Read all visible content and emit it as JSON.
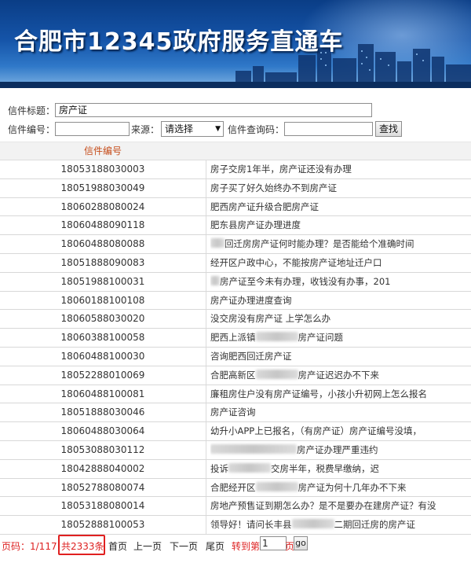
{
  "header": {
    "title": "合肥市12345政府服务直通车"
  },
  "form": {
    "subject_label": "信件标题：",
    "subject_value": "房产证",
    "number_label": "信件编号：",
    "number_value": "",
    "source_label": "来源：",
    "source_selected": "请选择",
    "query_code_label": "信件查询码：",
    "query_code_value": "",
    "search_button": "查找"
  },
  "table": {
    "header_number": "信件编号",
    "rows": [
      {
        "id": "18053188030003",
        "subject": "房子交房1年半，房产证还没有办理"
      },
      {
        "id": "18051988030049",
        "subject": "房子买了好久始终办不到房产证"
      },
      {
        "id": "18060288080024",
        "subject": "肥西房产证升级合肥房产证"
      },
      {
        "id": "18060488090118",
        "subject": "肥东县房产证办理进度"
      },
      {
        "id": "18060488080088",
        "subject": "回迁房房产证何时能办理？是否能给个准确时间"
      },
      {
        "id": "18051888090083",
        "subject": "经开区户政中心，不能按房产证地址迁户口"
      },
      {
        "id": "18051988100031",
        "subject": "房产证至今未有办理，收钱没有办事，201"
      },
      {
        "id": "18060188100108",
        "subject": "房产证办理进度查询"
      },
      {
        "id": "18060588030020",
        "subject": "没交房没有房产证 上学怎么办"
      },
      {
        "id": "18060388100058",
        "subject": "肥西上派镇",
        "subject_after": "房产证问题"
      },
      {
        "id": "18060488100030",
        "subject": "咨询肥西回迁房产证"
      },
      {
        "id": "18052288010069",
        "subject": "合肥高新区",
        "subject_after": "房产证迟迟办不下来"
      },
      {
        "id": "18060488100081",
        "subject": "廉租房住户没有房产证编号，小孩小升初网上怎么报名"
      },
      {
        "id": "18051888030046",
        "subject": "房产证咨询"
      },
      {
        "id": "18060488030064",
        "subject": "幼升小APP上已报名，（有房产证）房产证编号没填，"
      },
      {
        "id": "18053088030112",
        "subject": "",
        "subject_after": "房产证办理严重违约"
      },
      {
        "id": "18042888040002",
        "subject": "投诉",
        "subject_after": "交房半年，税费早缴纳，迟"
      },
      {
        "id": "18052788080074",
        "subject": "合肥经开区",
        "subject_after": "房产证为何十几年办不下来"
      },
      {
        "id": "18053188080014",
        "subject": "房地产预售证到期怎么办？是不是要办在建房产证？有没"
      },
      {
        "id": "18052888100053",
        "subject": "领导好！请问长丰县",
        "subject_after": "二期回迁房的房产证"
      }
    ]
  },
  "pager": {
    "page_info": "页码：1/117",
    "total": "共2333条",
    "first": "首页",
    "prev": "上一页",
    "next": "下一页",
    "last": "尾页",
    "goto_label": "转到第",
    "goto_value": "1",
    "page_unit": "页",
    "go": "go"
  }
}
